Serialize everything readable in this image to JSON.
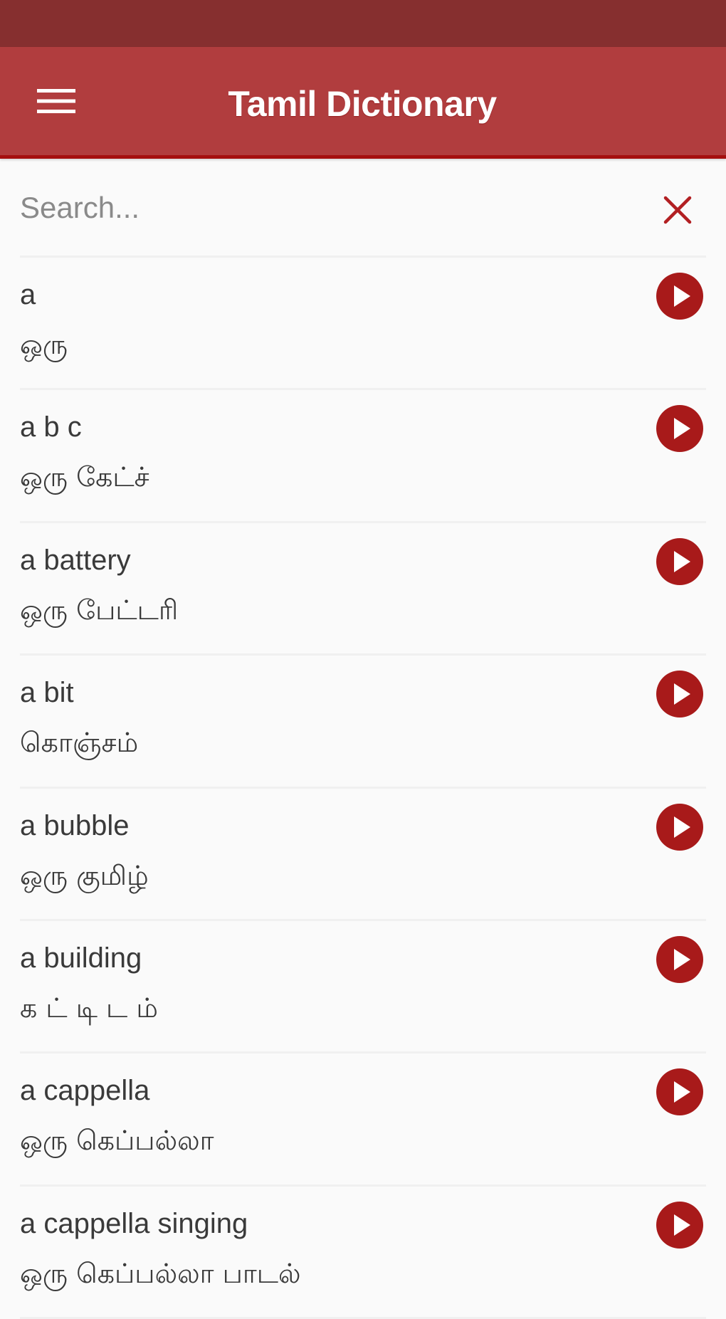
{
  "app": {
    "title": "Tamil Dictionary",
    "menu_icon": "hamburger-menu-icon",
    "colors": {
      "status_bar": "#862f2f",
      "app_bar": "#b13d3e",
      "accent": "#a81a1a",
      "background": "#fafafa"
    }
  },
  "search": {
    "value": "",
    "placeholder": "Search...",
    "clear_icon": "close-icon"
  },
  "entries": [
    {
      "english": "a",
      "tamil": "ஒரு",
      "action_icon": "play-circle-icon"
    },
    {
      "english": "a b c",
      "tamil": "ஒரு கேட்ச்",
      "action_icon": "play-circle-icon"
    },
    {
      "english": "a battery",
      "tamil": "ஒரு பேட்டரி",
      "action_icon": "play-circle-icon"
    },
    {
      "english": "a bit",
      "tamil": "கொஞ்சம்",
      "action_icon": "play-circle-icon"
    },
    {
      "english": "a bubble",
      "tamil": "ஒரு குமிழ்",
      "action_icon": "play-circle-icon"
    },
    {
      "english": "a building",
      "tamil": "க ட் டி ட ம்",
      "action_icon": "play-circle-icon"
    },
    {
      "english": "a cappella",
      "tamil": "ஒரு கெப்பல்லா",
      "action_icon": "play-circle-icon"
    },
    {
      "english": "a cappella singing",
      "tamil": "ஒரு கெப்பல்லா பாடல்",
      "action_icon": "play-circle-icon"
    }
  ]
}
